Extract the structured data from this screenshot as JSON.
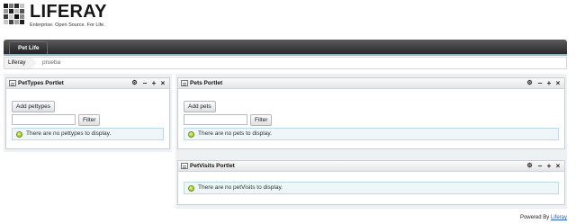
{
  "logo": {
    "text": "LIFERAY",
    "tagline": "Enterprise. Open Source. For Life."
  },
  "navigation": {
    "tabs": [
      {
        "label": "Pet Life"
      }
    ]
  },
  "breadcrumb": {
    "root": "Liferay",
    "current": "prueba"
  },
  "portlets": {
    "pettypes": {
      "title": "PetTypes Portlet",
      "add_button": "Add pettypes",
      "search_value": "",
      "filter_button": "Filter",
      "empty_message": "There are no pettypes to display."
    },
    "pets": {
      "title": "Pets Portlet",
      "add_button": "Add pets",
      "search_value": "",
      "filter_button": "Filter",
      "empty_message": "There are no pets to display."
    },
    "petvisits": {
      "title": "PetVisits Portlet",
      "empty_message": "There are no petVisits to display."
    }
  },
  "portlet_actions": {
    "configure": "⚙",
    "minimize": "−",
    "maximize": "+",
    "close": "×"
  },
  "footer": {
    "prefix": "Powered By",
    "link": "Liferay"
  },
  "colors": {
    "navbar": "#3a3a3a",
    "nav_accent": "#8ab4c9",
    "column_bg": "#eef1f4",
    "info_bg": "#eef6fa",
    "link": "#2a5db0"
  }
}
